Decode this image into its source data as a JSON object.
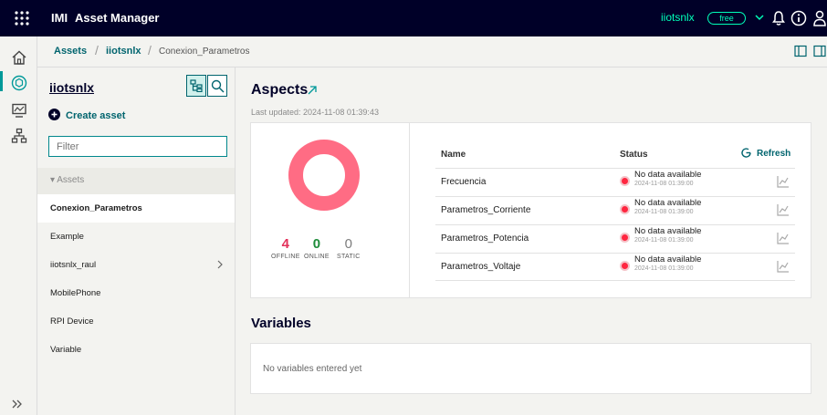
{
  "topbar": {
    "brand": "IMI",
    "app_title": "Asset Manager",
    "tenant": "iiotsnlx",
    "plan_badge": "free"
  },
  "breadcrumb": {
    "root": "Assets",
    "sep1": "/",
    "tenant": "iiotsnlx",
    "sep2": "/",
    "current": "Conexion_Parametros"
  },
  "asset_panel": {
    "title": "iiotsnlx",
    "create_label": "Create asset",
    "filter_placeholder": "Filter",
    "tree_header": "▾ Assets",
    "items": [
      {
        "label": "Conexion_Parametros",
        "selected": true
      },
      {
        "label": "Example"
      },
      {
        "label": "iiotsnlx_raul",
        "has_children": true
      },
      {
        "label": "MobilePhone"
      },
      {
        "label": "RPI Device"
      },
      {
        "label": "Variable"
      }
    ]
  },
  "aspects": {
    "title": "Aspects",
    "last_updated": "Last updated: 2024-11-08 01:39:43",
    "donut_color": "#ff6c84",
    "stats": [
      {
        "value": "4",
        "label": "OFFLINE",
        "color": "#e3315a"
      },
      {
        "value": "0",
        "label": "ONLINE",
        "color": "#1e8c3a"
      },
      {
        "value": "0",
        "label": "STATIC",
        "color": "#7d7d7d"
      }
    ],
    "table": {
      "col_name": "Name",
      "col_status": "Status",
      "refresh_label": "Refresh",
      "rows": [
        {
          "name": "Frecuencia",
          "status": "No data available",
          "timestamp": "2024-11-08 01:39:00"
        },
        {
          "name": "Parametros_Corriente",
          "status": "No data available",
          "timestamp": "2024-11-08 01:39:00"
        },
        {
          "name": "Parametros_Potencia",
          "status": "No data available",
          "timestamp": "2024-11-08 01:39:00"
        },
        {
          "name": "Parametros_Voltaje",
          "status": "No data available",
          "timestamp": "2024-11-08 01:39:00"
        }
      ]
    }
  },
  "variables": {
    "title": "Variables",
    "empty_text": "No variables entered yet"
  }
}
